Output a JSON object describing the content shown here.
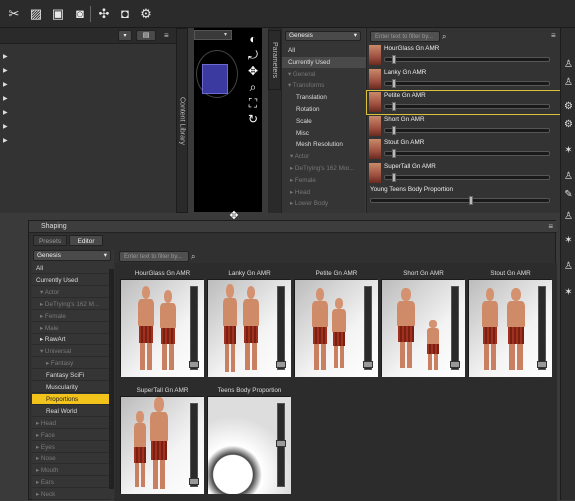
{
  "toolbar": {
    "icons": [
      "lasso-icon",
      "hatch-tool-icon",
      "image-edit-icon",
      "camera-image-icon",
      "node-tool-icon",
      "camera-icon",
      "gear-icon"
    ]
  },
  "viewport": {
    "nav_icons": [
      "tilt-icon",
      "rotate-icon",
      "move-icon",
      "zoom-icon",
      "frame-icon",
      "reset-icon"
    ]
  },
  "side_tabs": {
    "left": [
      "Content Library"
    ],
    "params": [
      "Parameters"
    ]
  },
  "filter": {
    "figure_select": "Genesis",
    "items": [
      {
        "label": "All",
        "dim": false
      },
      {
        "label": "Currently Used",
        "dim": false
      },
      {
        "label": "▾ General",
        "dim": true
      },
      {
        "label": "▾ Transforms",
        "dim": true
      },
      {
        "label": "Translation",
        "dim": false
      },
      {
        "label": "Rotation",
        "dim": false
      },
      {
        "label": "Scale",
        "dim": false
      },
      {
        "label": "Misc",
        "dim": false
      },
      {
        "label": "Mesh Resolution",
        "dim": false
      },
      {
        "label": "▾ Actor",
        "dim": true
      },
      {
        "label": "▸ DeTrying's 162 Mor...",
        "dim": true
      },
      {
        "label": "▸ Female",
        "dim": true
      },
      {
        "label": "▸ Head",
        "dim": true
      },
      {
        "label": "▸ Lower Body",
        "dim": true
      }
    ],
    "search_placeholder": "Enter text to filter by..."
  },
  "sliders": [
    {
      "label": "HourGlass Gn AMR",
      "value": 0.05
    },
    {
      "label": "Lanky Gn AMR",
      "value": 0.05
    },
    {
      "label": "Petite Gn AMR",
      "value": 0.05
    },
    {
      "label": "Short Gn AMR",
      "value": 0.05
    },
    {
      "label": "Stout Gn AMR",
      "value": 0.05
    },
    {
      "label": "SuperTall Gn AMR",
      "value": 0.05
    },
    {
      "label": "Young Teens Body Proportion",
      "value": 0.55
    }
  ],
  "shaping": {
    "title": "Shaping",
    "tabs": [
      "Presets",
      "Editor"
    ],
    "figure_select": "Genesis",
    "search_placeholder": "Enter text to filter by...",
    "list": [
      {
        "label": "All",
        "dim": false,
        "sel": false
      },
      {
        "label": "Currently Used",
        "dim": false,
        "sel": false
      },
      {
        "label": "▾ Actor",
        "dim": true,
        "sel": false
      },
      {
        "label": "▸ DeTrying's 162 M...",
        "dim": true,
        "sel": false
      },
      {
        "label": "▸ Female",
        "dim": true,
        "sel": false
      },
      {
        "label": "▸ Male",
        "dim": true,
        "sel": false
      },
      {
        "label": "▸ RawArt",
        "dim": false,
        "sel": false
      },
      {
        "label": "▾ Universal",
        "dim": true,
        "sel": false
      },
      {
        "label": "▸ Fantasy",
        "dim": true,
        "sel": false
      },
      {
        "label": "Fantasy SciFi",
        "dim": false,
        "sel": false
      },
      {
        "label": "Muscularity",
        "dim": false,
        "sel": false
      },
      {
        "label": "Proportions",
        "dim": false,
        "sel": true
      },
      {
        "label": "Real World",
        "dim": false,
        "sel": false
      },
      {
        "label": "▸ Head",
        "dim": true,
        "sel": false
      },
      {
        "label": "▸ Face",
        "dim": true,
        "sel": false
      },
      {
        "label": "▸ Eyes",
        "dim": true,
        "sel": false
      },
      {
        "label": "▸ Nose",
        "dim": true,
        "sel": false
      },
      {
        "label": "▸ Mouth",
        "dim": true,
        "sel": false
      },
      {
        "label": "▸ Ears",
        "dim": true,
        "sel": false
      },
      {
        "label": "▸ Neck",
        "dim": true,
        "sel": false
      }
    ],
    "tiles": [
      {
        "label": "HourGlass Gn AMR"
      },
      {
        "label": "Lanky Gn AMR"
      },
      {
        "label": "Petite Gn AMR"
      },
      {
        "label": "Short Gn AMR"
      },
      {
        "label": "Stout Gn AMR"
      },
      {
        "label": "SuperTall Gn AMR"
      },
      {
        "label": "Teens Body Proportion"
      }
    ]
  }
}
